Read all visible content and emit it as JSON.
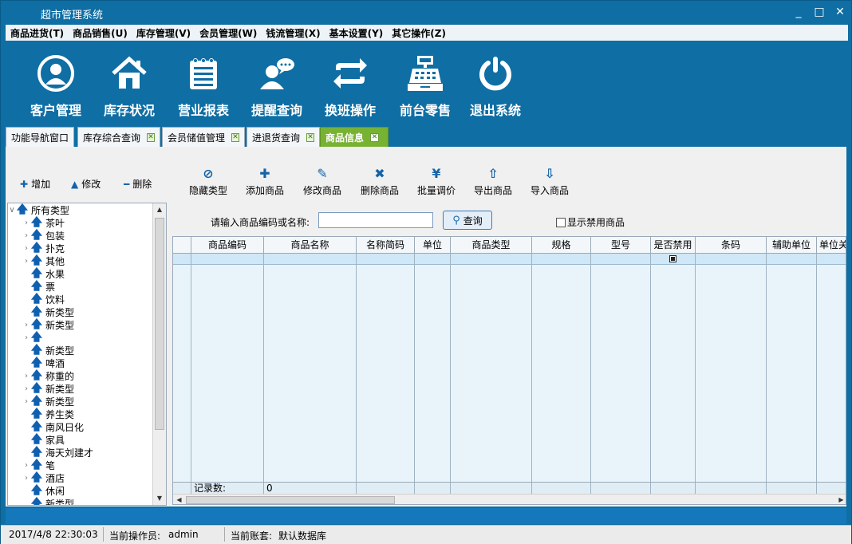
{
  "window": {
    "title": "超市管理系统",
    "minimize": "_",
    "maximize": "□",
    "close": "✕"
  },
  "menu": [
    "商品进货(T)",
    "商品销售(U)",
    "库存管理(V)",
    "会员管理(W)",
    "钱流管理(X)",
    "基本设置(Y)",
    "其它操作(Z)"
  ],
  "bigbar": [
    {
      "label": "客户管理",
      "icon": "user-circle-icon"
    },
    {
      "label": "库存状况",
      "icon": "house-icon"
    },
    {
      "label": "营业报表",
      "icon": "notepad-icon"
    },
    {
      "label": "提醒查询",
      "icon": "person-chat-icon"
    },
    {
      "label": "换班操作",
      "icon": "swap-arrows-icon"
    },
    {
      "label": "前台零售",
      "icon": "cash-register-icon"
    },
    {
      "label": "退出系统",
      "icon": "power-icon"
    }
  ],
  "tabs": [
    {
      "label": "功能导航窗口",
      "closable": false
    },
    {
      "label": "库存综合查询",
      "closable": true
    },
    {
      "label": "会员储值管理",
      "closable": true
    },
    {
      "label": "进退货查询",
      "closable": true
    },
    {
      "label": "商品信息",
      "closable": true,
      "active": true
    }
  ],
  "category_actions": {
    "add": "增加",
    "edit": "修改",
    "delete": "删除"
  },
  "product_toolbar": [
    "隐藏类型",
    "添加商品",
    "修改商品",
    "删除商品",
    "批量调价",
    "导出商品",
    "导入商品"
  ],
  "tree": {
    "root": "所有类型",
    "items": [
      "茶叶",
      "包装",
      "扑克",
      "其他",
      "水果",
      "票",
      "饮料",
      "新类型",
      "新类型",
      "",
      "新类型",
      "啤酒",
      "称重的",
      "新类型",
      "新类型",
      "养生类",
      "南风日化",
      "家具",
      "海天刘建才",
      "笔",
      "酒店",
      "休闲",
      "新类型"
    ],
    "expandable": [
      true,
      true,
      true,
      true,
      false,
      false,
      false,
      false,
      true,
      true,
      false,
      false,
      true,
      true,
      true,
      false,
      false,
      false,
      false,
      true,
      true,
      false,
      false
    ]
  },
  "search": {
    "label": "请输入商品编码或名称:",
    "value": "",
    "button": "查询",
    "show_disabled_label": "显示禁用商品"
  },
  "grid": {
    "columns": [
      "商品编码",
      "商品名称",
      "名称简码",
      "单位",
      "商品类型",
      "规格",
      "型号",
      "是否禁用",
      "条码",
      "辅助单位",
      "单位关"
    ],
    "footer_label": "记录数:",
    "footer_value": "0"
  },
  "status": {
    "datetime": "2017/4/8 22:30:03",
    "operator_label": "当前操作员:",
    "operator": "admin",
    "account_label": "当前账套:",
    "account": "默认数据库"
  },
  "colors": {
    "frame": "#0f6ea4",
    "active_tab": "#78b232",
    "grid_bg": "#e9f4fa"
  }
}
